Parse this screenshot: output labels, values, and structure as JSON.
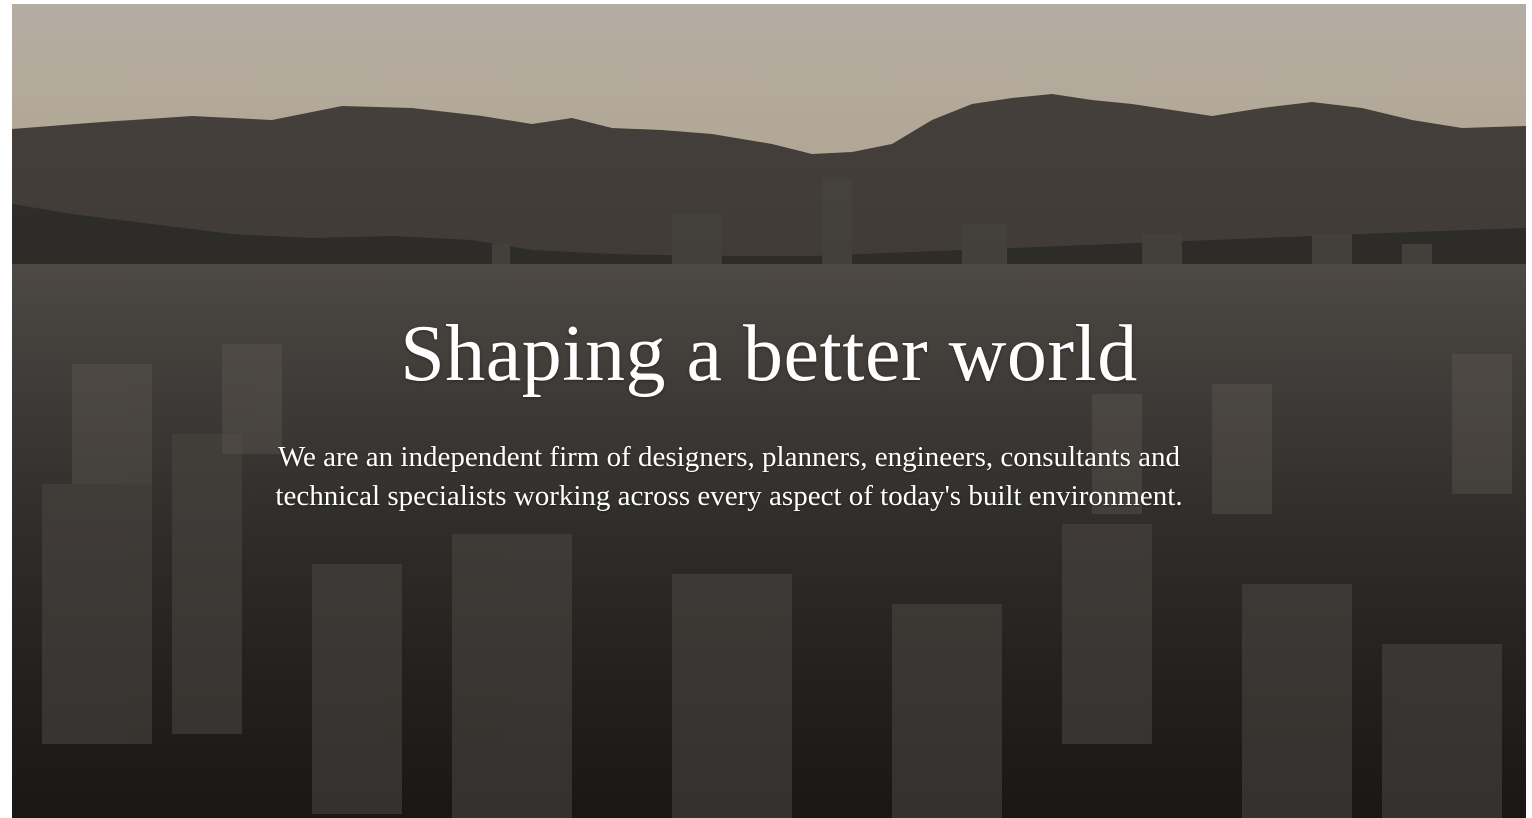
{
  "hero": {
    "title": "Shaping a better world",
    "subtitle": "We are an independent firm of designers, planners, engineers, consultants and technical specialists working across every aspect of today's built environment."
  },
  "colors": {
    "sky_top": "#c9c2b3",
    "sky_bottom": "#e0c9a3",
    "mountains": "#4a4440",
    "city_dark": "#2f2d2b",
    "text": "#ffffff"
  }
}
